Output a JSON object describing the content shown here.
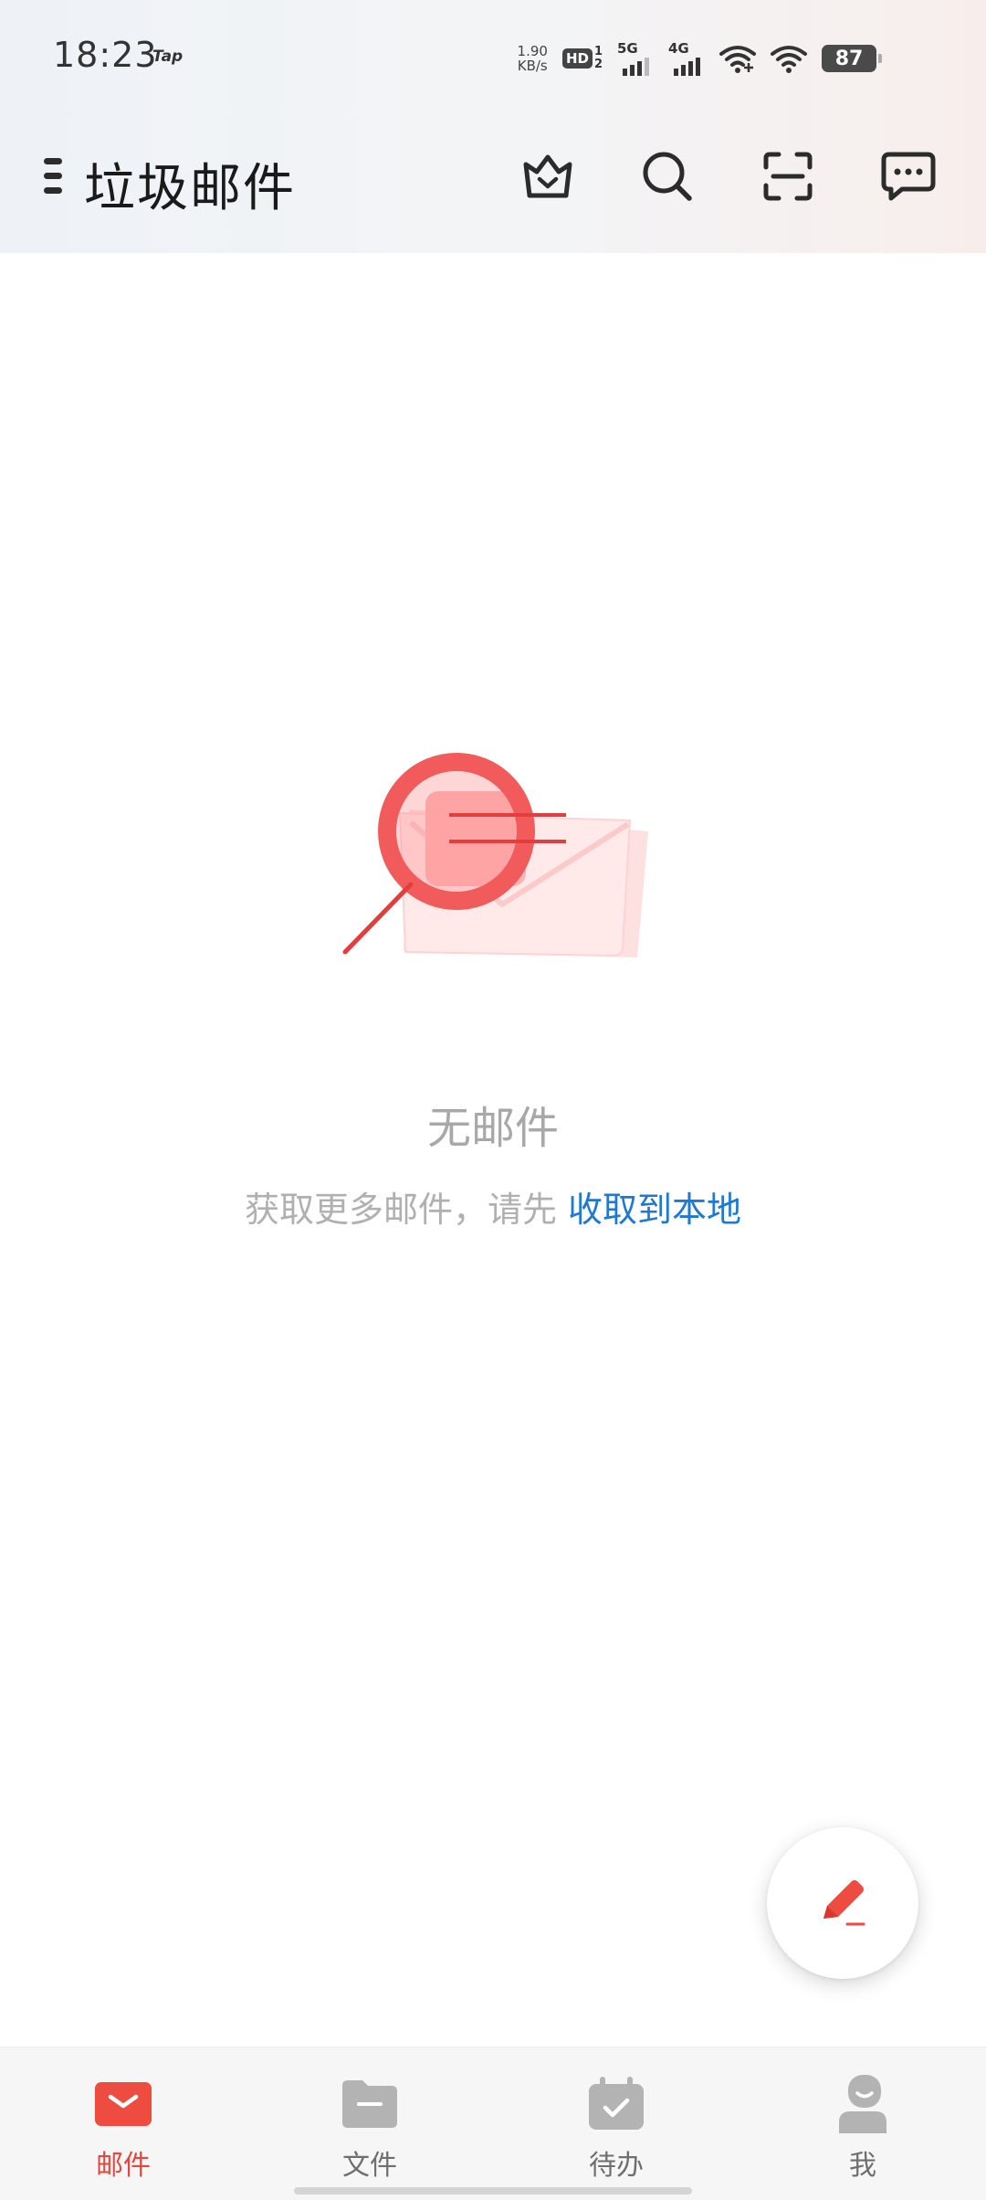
{
  "status_bar": {
    "time": "18:23",
    "app_indicator": "Tap",
    "net_speed_value": "1.90",
    "net_speed_unit": "KB/s",
    "hd_label": "HD",
    "sim_1": "1",
    "sim_2": "2",
    "signal_5g_label": "5G",
    "signal_4g_label": "4G",
    "battery_level": "87"
  },
  "app_bar": {
    "title": "垃圾邮件",
    "icons": [
      "crown-icon",
      "search-icon",
      "scan-icon",
      "message-icon"
    ]
  },
  "empty_state": {
    "title": "无邮件",
    "hint_prefix": "获取更多邮件，请先 ",
    "hint_link": "收取到本地"
  },
  "fab": {
    "icon": "pencil-icon"
  },
  "bottom_nav": {
    "items": [
      {
        "label": "邮件",
        "icon": "mail-icon",
        "active": true
      },
      {
        "label": "文件",
        "icon": "folder-icon",
        "active": false
      },
      {
        "label": "待办",
        "icon": "todo-icon",
        "active": false
      },
      {
        "label": "我",
        "icon": "profile-icon",
        "active": false
      }
    ]
  },
  "colors": {
    "accent_red": "#e8453c",
    "link_blue": "#1f78d1",
    "muted_text": "#b0b0b0"
  }
}
